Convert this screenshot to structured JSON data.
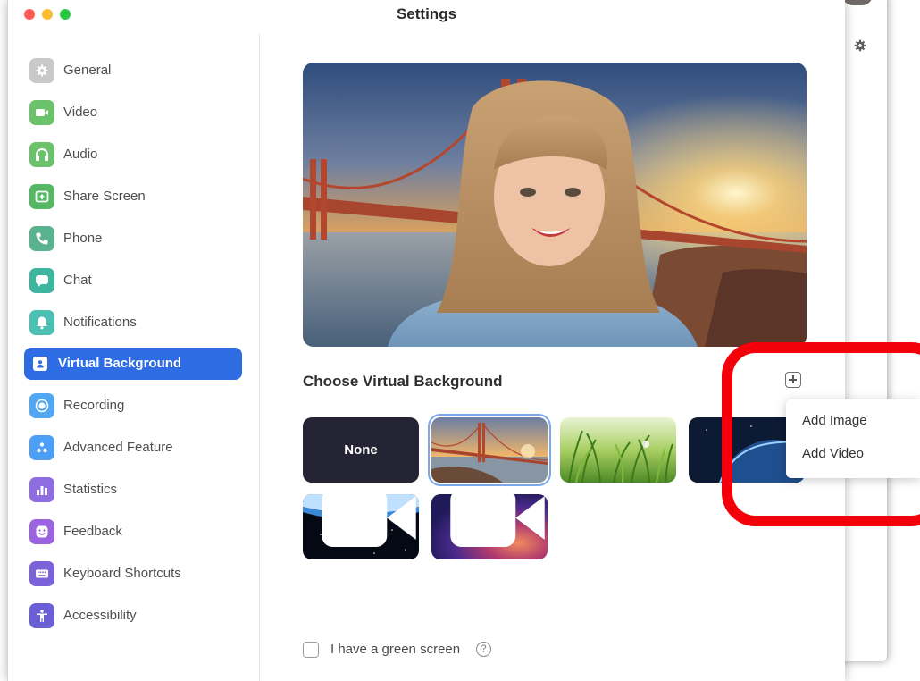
{
  "window": {
    "title": "Settings"
  },
  "sidebar": {
    "items": [
      {
        "label": "General",
        "icon": "gear-icon",
        "color": "#bdbdbd",
        "active": false
      },
      {
        "label": "Video",
        "icon": "video-camera-icon",
        "color": "#6cc26a",
        "active": false
      },
      {
        "label": "Audio",
        "icon": "headphones-icon",
        "color": "#6cc26a",
        "active": false
      },
      {
        "label": "Share Screen",
        "icon": "share-screen-icon",
        "color": "#56b865",
        "active": false
      },
      {
        "label": "Phone",
        "icon": "phone-icon",
        "color": "#5ab38f",
        "active": false
      },
      {
        "label": "Chat",
        "icon": "chat-bubble-icon",
        "color": "#3eb59f",
        "active": false
      },
      {
        "label": "Notifications",
        "icon": "bell-icon",
        "color": "#4cc0b3",
        "active": false
      },
      {
        "label": "Virtual Background",
        "icon": "portrait-icon",
        "color": "#2d6ce3",
        "active": true
      },
      {
        "label": "Recording",
        "icon": "record-icon",
        "color": "#51a7f2",
        "active": false
      },
      {
        "label": "Advanced Feature",
        "icon": "advanced-dots-icon",
        "color": "#4d9ef5",
        "active": false
      },
      {
        "label": "Statistics",
        "icon": "bar-chart-icon",
        "color": "#8d6ddf",
        "active": false
      },
      {
        "label": "Feedback",
        "icon": "smiley-icon",
        "color": "#9b63e0",
        "active": false
      },
      {
        "label": "Keyboard Shortcuts",
        "icon": "keyboard-icon",
        "color": "#7c62d8",
        "active": false
      },
      {
        "label": "Accessibility",
        "icon": "accessibility-person-icon",
        "color": "#6b5fd8",
        "active": false
      }
    ]
  },
  "main": {
    "choose_title": "Choose Virtual Background",
    "add_button_icon": "plus-icon",
    "thumbnails": [
      {
        "label": "None",
        "kind": "none",
        "selected": false
      },
      {
        "label": "",
        "kind": "golden-gate-bridge",
        "selected": true
      },
      {
        "label": "",
        "kind": "grass",
        "selected": false
      },
      {
        "label": "",
        "kind": "earth-from-space",
        "selected": false
      },
      {
        "label": "",
        "kind": "earth-horizon-video",
        "selected": false
      },
      {
        "label": "",
        "kind": "purple-gradient-video",
        "selected": false
      }
    ],
    "green_screen": {
      "label": "I have a green screen",
      "checked": false,
      "help_icon": "?"
    }
  },
  "add_menu": {
    "items": [
      "Add Image",
      "Add Video"
    ]
  },
  "colors": {
    "accent": "#2d6ce3",
    "highlight": "#f4000a"
  }
}
